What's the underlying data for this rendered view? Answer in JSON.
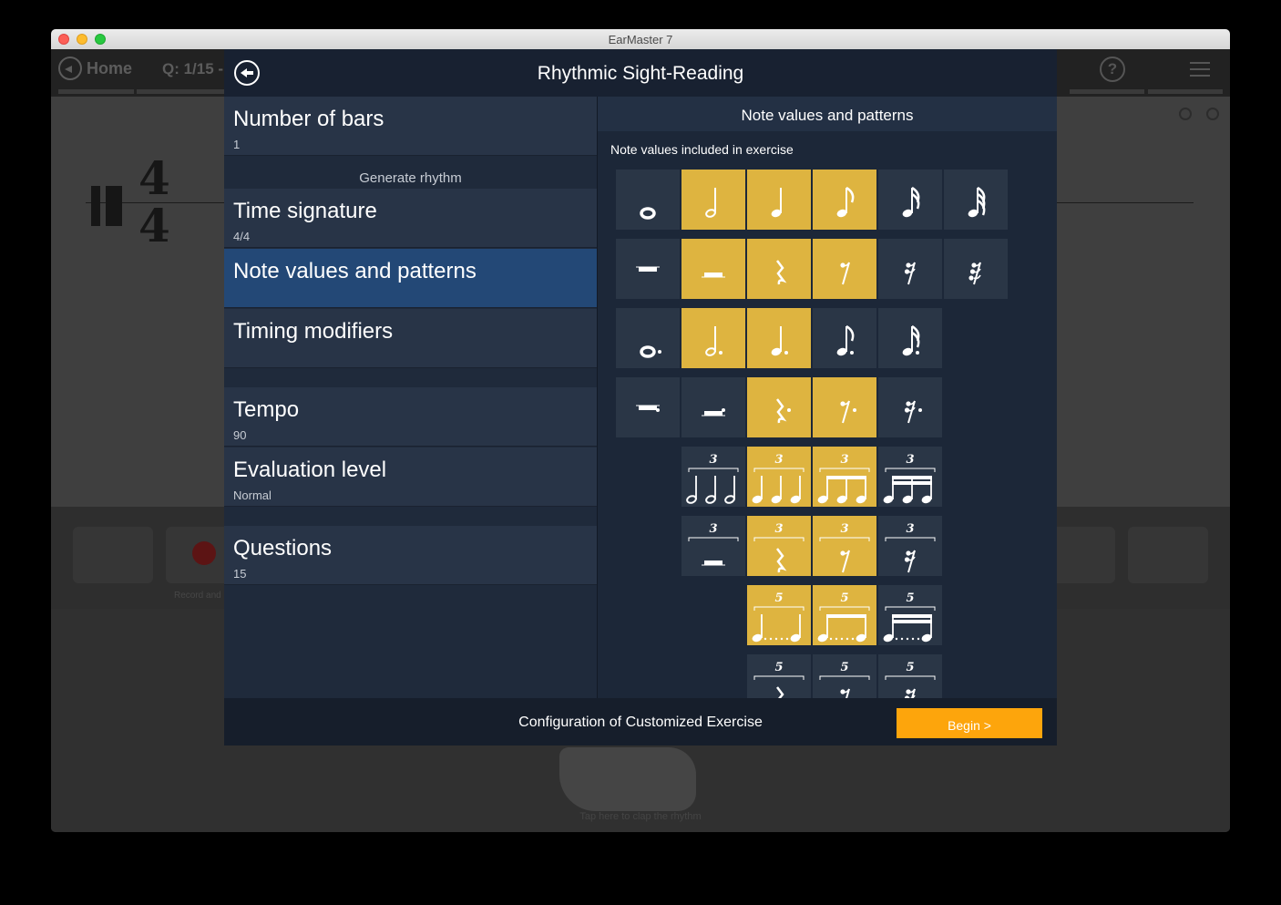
{
  "window": {
    "title": "EarMaster 7"
  },
  "background": {
    "home_label": "Home",
    "question_label": "Q: 1/15 -",
    "help_glyph": "?",
    "time_sig_top": "4",
    "time_sig_bottom": "4",
    "record_label": "Record and",
    "tap_hint": "Tap here to clap the rhythm"
  },
  "dialog": {
    "title": "Rhythmic Sight-Reading",
    "settings": [
      {
        "title": "Number of bars",
        "value": "1"
      },
      {
        "title": "Time signature",
        "value": "4/4"
      },
      {
        "title": "Note values and patterns",
        "value": ""
      },
      {
        "title": "Timing modifiers",
        "value": ""
      },
      {
        "title": "Tempo",
        "value": "90"
      },
      {
        "title": "Evaluation level",
        "value": "Normal"
      },
      {
        "title": "Questions",
        "value": "15"
      }
    ],
    "section_generate": "Generate rhythm",
    "panel": {
      "title": "Note values and patterns",
      "subtitle": "Note values included in exercise"
    },
    "grid": {
      "row_notes": [
        {
          "name": "whole-note",
          "selected": false
        },
        {
          "name": "half-note",
          "selected": true
        },
        {
          "name": "quarter-note",
          "selected": true
        },
        {
          "name": "eighth-note",
          "selected": true
        },
        {
          "name": "sixteenth-note",
          "selected": false
        },
        {
          "name": "thirty-second-note",
          "selected": false
        }
      ],
      "row_rests": [
        {
          "name": "whole-rest",
          "selected": false
        },
        {
          "name": "half-rest",
          "selected": true
        },
        {
          "name": "quarter-rest",
          "selected": true
        },
        {
          "name": "eighth-rest",
          "selected": true
        },
        {
          "name": "sixteenth-rest",
          "selected": false
        },
        {
          "name": "thirty-second-rest",
          "selected": false
        }
      ],
      "row_dotted_notes": [
        {
          "name": "dotted-whole-note",
          "selected": false
        },
        {
          "name": "dotted-half-note",
          "selected": true
        },
        {
          "name": "dotted-quarter-note",
          "selected": true
        },
        {
          "name": "dotted-eighth-note",
          "selected": false
        },
        {
          "name": "dotted-sixteenth-note",
          "selected": false
        }
      ],
      "row_dotted_rests": [
        {
          "name": "dotted-whole-rest",
          "selected": false
        },
        {
          "name": "dotted-half-rest",
          "selected": false
        },
        {
          "name": "dotted-quarter-rest",
          "selected": true
        },
        {
          "name": "dotted-eighth-rest",
          "selected": true
        },
        {
          "name": "dotted-sixteenth-rest",
          "selected": false
        }
      ],
      "row_triplet_notes": [
        {
          "name": "half-note-triplet",
          "label": "3",
          "selected": false
        },
        {
          "name": "quarter-note-triplet",
          "label": "3",
          "selected": true
        },
        {
          "name": "eighth-note-triplet",
          "label": "3",
          "selected": true
        },
        {
          "name": "sixteenth-note-triplet",
          "label": "3",
          "selected": false
        }
      ],
      "row_triplet_rests": [
        {
          "name": "half-rest-triplet",
          "label": "3",
          "selected": false
        },
        {
          "name": "quarter-rest-triplet",
          "label": "3",
          "selected": true
        },
        {
          "name": "eighth-rest-triplet",
          "label": "3",
          "selected": true
        },
        {
          "name": "sixteenth-rest-triplet",
          "label": "3",
          "selected": false
        }
      ],
      "row_quintuplet_notes": [
        {
          "name": "quarter-note-quintuplet",
          "label": "5",
          "selected": true
        },
        {
          "name": "eighth-note-quintuplet",
          "label": "5",
          "selected": true
        },
        {
          "name": "sixteenth-note-quintuplet",
          "label": "5",
          "selected": false
        }
      ],
      "row_quintuplet_rests": [
        {
          "name": "quarter-rest-quintuplet",
          "label": "5",
          "selected": false
        },
        {
          "name": "eighth-rest-quintuplet",
          "label": "5",
          "selected": false
        },
        {
          "name": "sixteenth-rest-quintuplet",
          "label": "5",
          "selected": false
        }
      ]
    },
    "footer": {
      "label": "Configuration of Customized Exercise",
      "begin_label": "Begin >"
    }
  },
  "colors": {
    "selected_cell": "#deb440",
    "unselected_cell": "#2a3646",
    "active_setting": "#234876",
    "begin_button": "#fda50c"
  }
}
